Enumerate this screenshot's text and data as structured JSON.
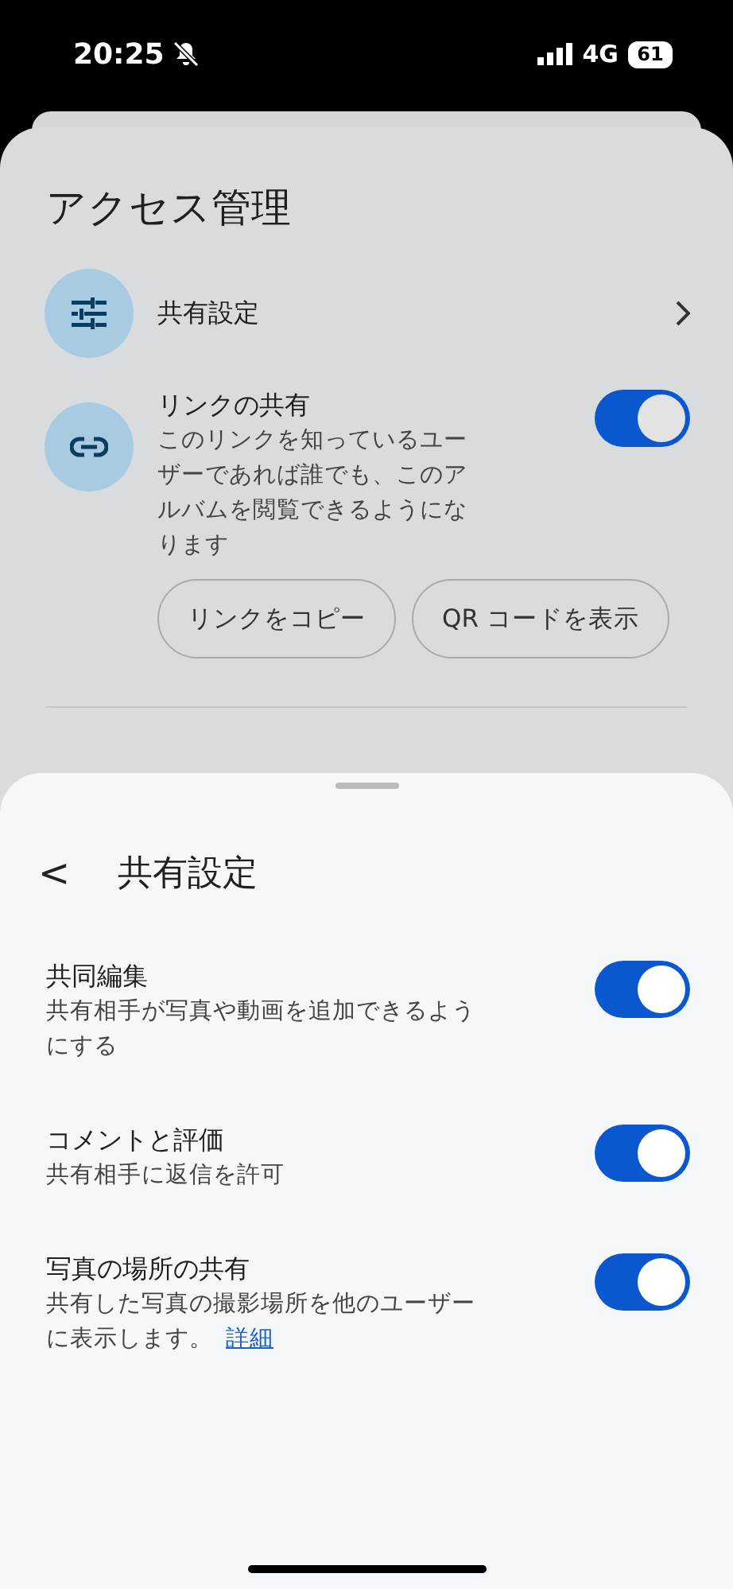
{
  "status_bar": {
    "time": "20:25",
    "network": "4G",
    "battery": "61"
  },
  "access_panel": {
    "title": "アクセス管理",
    "items": [
      {
        "kind": "nav",
        "label": "共有設定"
      },
      {
        "kind": "toggle",
        "label": "リンクの共有",
        "description": "このリンクを知っているユーザーであれば誰でも、このアルバムを閲覧できるようになります",
        "on": true,
        "buttons": [
          "リンクをコピー",
          "QR コードを表示"
        ]
      }
    ]
  },
  "sheet": {
    "back": "<",
    "title": "共有設定",
    "settings": [
      {
        "label": "共同編集",
        "description": "共有相手が写真や動画を追加できるようにする",
        "on": true
      },
      {
        "label": "コメントと評価",
        "description": "共有相手に返信を許可",
        "on": true
      },
      {
        "label": "写真の場所の共有",
        "description": "共有した写真の撮影場所を他のユーザーに表示します。",
        "link": "詳細",
        "on": true
      }
    ]
  }
}
